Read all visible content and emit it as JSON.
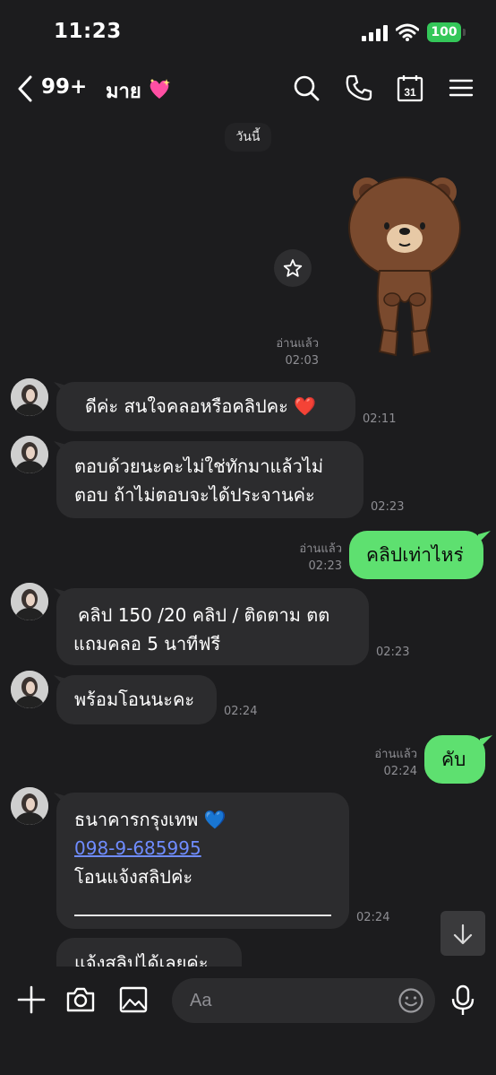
{
  "status_bar": {
    "time": "11:23",
    "battery": "100"
  },
  "header": {
    "back_count": "99+",
    "contact_name": "มาย"
  },
  "date_chip": "วันนี้",
  "messages": [
    {
      "side": "out",
      "type": "sticker",
      "read": "อ่านแล้ว",
      "time": "02:03"
    },
    {
      "side": "in",
      "text": "ดีค่ะ สนใจคลอหรือคลิปคะ ❤️",
      "time": "02:11"
    },
    {
      "side": "in",
      "lines": [
        "ตอบด้วยนะคะไม่ใช่ทักมาแล้วไม่",
        "ตอบ ถ้าไม่ตอบจะได้ประจานค่ะ"
      ],
      "time": "02:23"
    },
    {
      "side": "out",
      "text": "คลิปเท่าไหร่",
      "read": "อ่านแล้ว",
      "time": "02:23"
    },
    {
      "side": "in",
      "lines": [
        "คลิป 150 /20 คลิป / ติดตาม ตต",
        "แถมคลอ 5 นาทีฟรี"
      ],
      "time": "02:23"
    },
    {
      "side": "in",
      "text": "พร้อมโอนนะคะ",
      "time": "02:24"
    },
    {
      "side": "out",
      "text": "คับ",
      "read": "อ่านแล้ว",
      "time": "02:24"
    },
    {
      "side": "in",
      "bank": "ธนาคารกรุงเทพ 💙",
      "account": "098-9-685995",
      "note": "โอนแจ้งสลิปค่ะ",
      "time": "02:24"
    },
    {
      "side": "in",
      "text": "แจ้งสลิปได้เลยค่ะ"
    }
  ],
  "input": {
    "placeholder": "Aa"
  },
  "icons": {
    "header": [
      "back-chevron-icon",
      "search-icon",
      "phone-icon",
      "calendar-icon",
      "menu-icon"
    ],
    "calendar_day": "31",
    "input_bar": [
      "plus-icon",
      "camera-icon",
      "image-icon",
      "emoji-icon",
      "mic-icon"
    ]
  },
  "colors": {
    "background": "#1c1c1e",
    "incoming_bubble": "#2c2c2e",
    "outgoing_bubble": "#5ee070",
    "link": "#6f8cff",
    "battery": "#34c759"
  }
}
